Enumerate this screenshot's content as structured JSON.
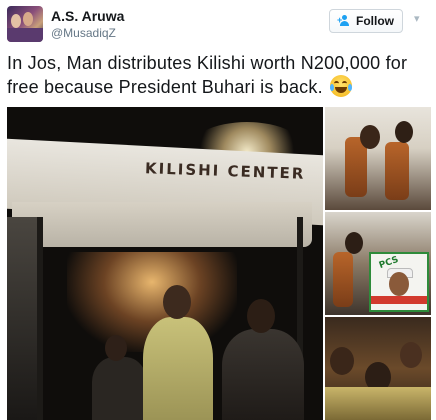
{
  "user": {
    "display_name": "A.S. Aruwa",
    "handle": "@MusadiqZ"
  },
  "actions": {
    "follow_label": "Follow"
  },
  "tweet": {
    "text": "In Jos, Man distributes Kilishi worth N200,000 for free because President Buhari is back."
  },
  "media": {
    "main_sign_text": "KILISHI CENTER",
    "poster_text": "PCS",
    "thumbnail_count": 3
  },
  "icons": {
    "avatar": "avatar",
    "follow": "follow-user-icon",
    "menu": "chevron-down-icon",
    "emoji": "face-with-tears-of-joy-emoji"
  },
  "colors": {
    "accent": "#1da1f2",
    "text": "#14171a",
    "muted": "#657786"
  }
}
